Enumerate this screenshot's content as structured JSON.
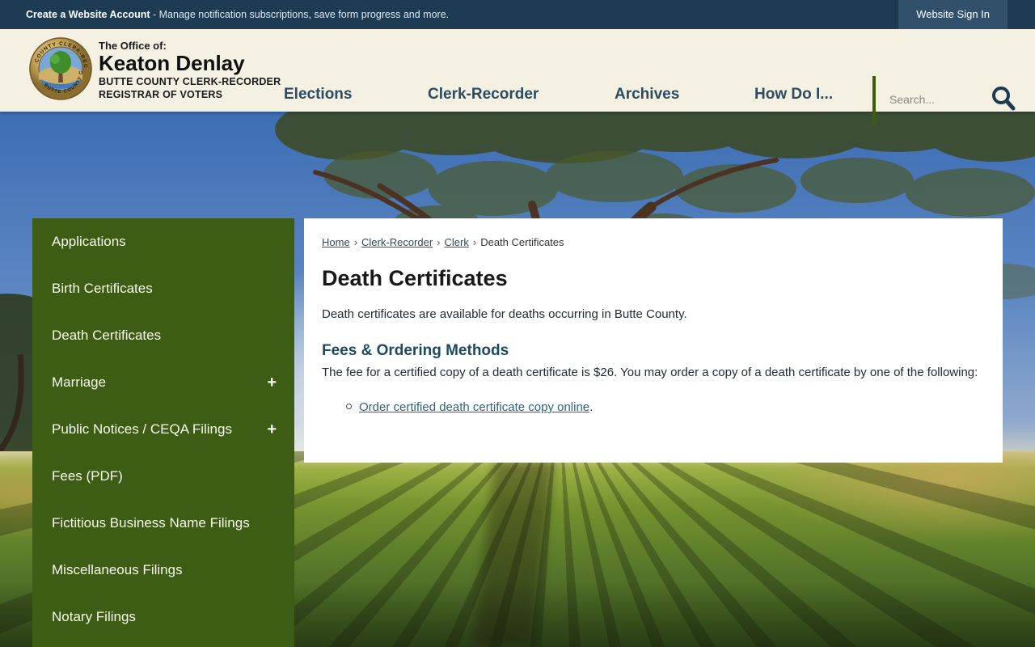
{
  "topbar": {
    "promo_bold": "Create a Website Account",
    "promo_rest": " - Manage notification subscriptions, save form progress and more.",
    "signin_label": "Website Sign In"
  },
  "header": {
    "office_pre": "The Office of:",
    "office_name": "Keaton Denlay",
    "office_line1": "BUTTE COUNTY CLERK-RECORDER",
    "office_line2": "REGISTRAR OF VOTERS",
    "nav": [
      {
        "label": "Elections"
      },
      {
        "label": "Clerk-Recorder"
      },
      {
        "label": "Archives"
      },
      {
        "label": "How Do I..."
      }
    ],
    "search_placeholder": "Search..."
  },
  "sidebar": {
    "items": [
      {
        "label": "Applications",
        "expand_symbol": ""
      },
      {
        "label": "Birth Certificates",
        "expand_symbol": ""
      },
      {
        "label": "Death Certificates",
        "expand_symbol": ""
      },
      {
        "label": "Marriage",
        "expand_symbol": "+"
      },
      {
        "label": "Public Notices / CEQA Filings",
        "expand_symbol": "+"
      },
      {
        "label": "Fees (PDF)",
        "expand_symbol": ""
      },
      {
        "label": "Fictitious Business Name Filings",
        "expand_symbol": ""
      },
      {
        "label": "Miscellaneous Filings",
        "expand_symbol": ""
      },
      {
        "label": "Notary Filings",
        "expand_symbol": ""
      }
    ]
  },
  "main": {
    "breadcrumb_separator": "›",
    "breadcrumb": [
      {
        "label": "Home"
      },
      {
        "label": "Clerk-Recorder"
      },
      {
        "label": "Clerk"
      },
      {
        "label": "Death Certificates"
      }
    ],
    "title": "Death Certificates",
    "intro": "Death certificates are available for deaths occurring in Butte County.",
    "section_heading": "Fees & Ordering Methods",
    "section_text": "The fee for a certified copy of a death certificate is $26. You may order a copy of a death certificate by one of the following:",
    "list": [
      {
        "link_text": "Order certified death certificate copy online",
        "suffix": "."
      }
    ]
  },
  "colors": {
    "topbar_bg": "#1d3c53",
    "signin_bg": "#30506b",
    "header_bg": "#f4f0e2",
    "nav_text": "#2b4b60",
    "sidebar_bg": "#3c5d13",
    "section_heading": "#1c4a63",
    "link": "#2f637e",
    "divider_green": "#3a5f0c"
  }
}
